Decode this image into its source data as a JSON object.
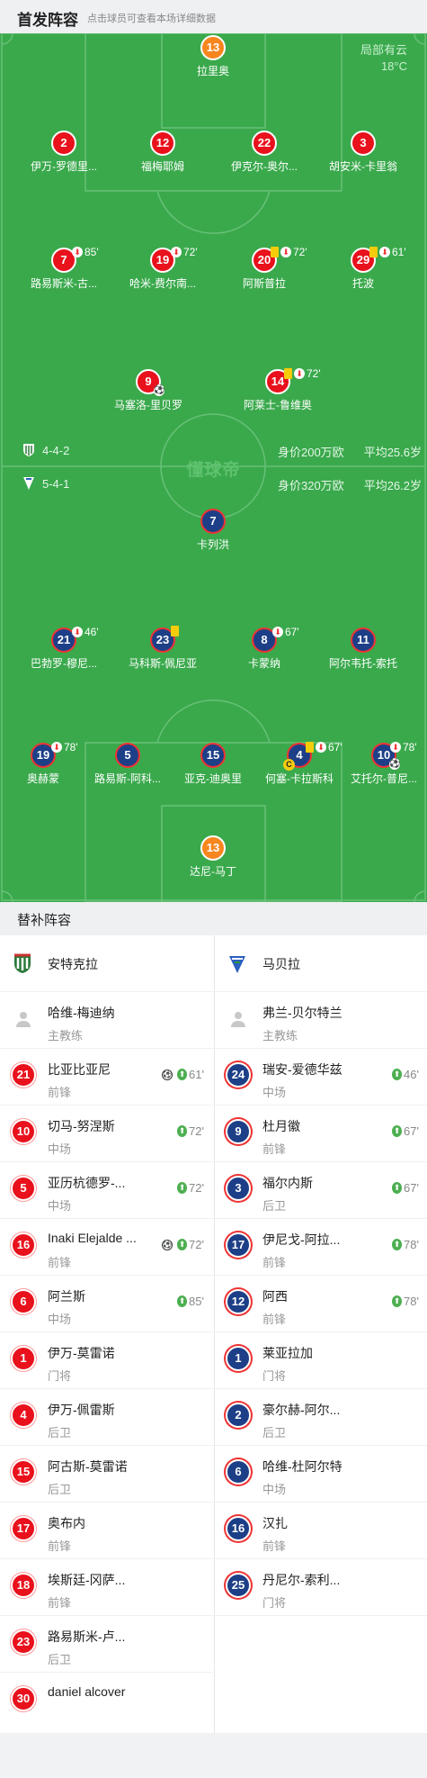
{
  "starting": {
    "title": "首发阵容",
    "hint": "点击球员可查看本场详细数据"
  },
  "weather": {
    "cond": "局部有云",
    "temp": "18°C"
  },
  "home": {
    "formation": "4-4-2",
    "value": "身价200万欧",
    "age": "平均25.6岁"
  },
  "away": {
    "formation": "5-4-1",
    "value": "身价320万欧",
    "age": "平均26.2岁"
  },
  "watermark": "懂球帝",
  "home_players": [
    {
      "num": "13",
      "name": "拉里奥",
      "gk": true
    },
    {
      "num": "2",
      "name": "伊万-罗德里..."
    },
    {
      "num": "12",
      "name": "福梅耶姆"
    },
    {
      "num": "22",
      "name": "伊克尔-奥尔..."
    },
    {
      "num": "3",
      "name": "胡安米-卡里翁"
    },
    {
      "num": "7",
      "name": "路易斯米-古...",
      "ev": "85'"
    },
    {
      "num": "19",
      "name": "哈米-费尔南...",
      "ev": "72'"
    },
    {
      "num": "20",
      "name": "阿斯普拉",
      "ev": "72'"
    },
    {
      "num": "29",
      "name": "托波",
      "ev": "61'"
    },
    {
      "num": "9",
      "name": "马塞洛-里贝罗"
    },
    {
      "num": "14",
      "name": "阿莱士-鲁维奥",
      "ev": "72'"
    }
  ],
  "away_players": [
    {
      "num": "7",
      "name": "卡列洪"
    },
    {
      "num": "21",
      "name": "巴勃罗-穆尼...",
      "ev": "46'"
    },
    {
      "num": "23",
      "name": "马科斯-佩尼亚"
    },
    {
      "num": "8",
      "name": "卡蒙纳",
      "ev": "67'"
    },
    {
      "num": "11",
      "name": "阿尔韦托-索托"
    },
    {
      "num": "19",
      "name": "奥赫蒙",
      "ev": "78'"
    },
    {
      "num": "5",
      "name": "路易斯-阿科..."
    },
    {
      "num": "15",
      "name": "亚克-迪奥里"
    },
    {
      "num": "4",
      "name": "何塞-卡拉斯科",
      "ev": "67'"
    },
    {
      "num": "10",
      "name": "艾托尔-普尼...",
      "ev": "78'"
    },
    {
      "num": "13",
      "name": "达尼-马丁",
      "gk": true
    }
  ],
  "subs": {
    "title": "替补阵容",
    "home_team": "安特克拉",
    "away_team": "马贝拉",
    "home_coach": {
      "name": "哈维-梅迪纳",
      "role": "主教练"
    },
    "away_coach": {
      "name": "弗兰-贝尔特兰",
      "role": "主教练"
    },
    "home": [
      {
        "num": "21",
        "name": "比亚比亚尼",
        "pos": "前锋",
        "ev": "61'"
      },
      {
        "num": "10",
        "name": "切马-努涅斯",
        "pos": "中场",
        "ev": "72'"
      },
      {
        "num": "5",
        "name": "亚历杭德罗-...",
        "pos": "中场",
        "ev": "72'"
      },
      {
        "num": "16",
        "name": "Inaki Elejalde ...",
        "pos": "前锋",
        "ev": "72'"
      },
      {
        "num": "6",
        "name": "阿兰斯",
        "pos": "中场",
        "ev": "85'"
      },
      {
        "num": "1",
        "name": "伊万-莫雷诺",
        "pos": "门将",
        "ev": ""
      },
      {
        "num": "4",
        "name": "伊万-佩雷斯",
        "pos": "后卫",
        "ev": ""
      },
      {
        "num": "15",
        "name": "阿古斯-莫雷诺",
        "pos": "后卫",
        "ev": ""
      },
      {
        "num": "17",
        "name": "奥布内",
        "pos": "前锋",
        "ev": ""
      },
      {
        "num": "18",
        "name": "埃斯廷-冈萨...",
        "pos": "前锋",
        "ev": ""
      },
      {
        "num": "23",
        "name": "路易斯米-卢...",
        "pos": "后卫",
        "ev": ""
      },
      {
        "num": "30",
        "name": "daniel alcover",
        "pos": "",
        "ev": ""
      }
    ],
    "away": [
      {
        "num": "24",
        "name": "瑞安-爱德华兹",
        "pos": "中场",
        "ev": "46'"
      },
      {
        "num": "9",
        "name": "杜月徽",
        "pos": "前锋",
        "ev": "67'"
      },
      {
        "num": "3",
        "name": "福尔内斯",
        "pos": "后卫",
        "ev": "67'"
      },
      {
        "num": "17",
        "name": "伊尼戈-阿拉...",
        "pos": "前锋",
        "ev": "78'"
      },
      {
        "num": "12",
        "name": "阿西",
        "pos": "前锋",
        "ev": "78'"
      },
      {
        "num": "1",
        "name": "莱亚拉加",
        "pos": "门将",
        "ev": ""
      },
      {
        "num": "2",
        "name": "豪尔赫-阿尔...",
        "pos": "后卫",
        "ev": ""
      },
      {
        "num": "6",
        "name": "哈维-杜阿尔特",
        "pos": "中场",
        "ev": ""
      },
      {
        "num": "16",
        "name": "汉扎",
        "pos": "前锋",
        "ev": ""
      },
      {
        "num": "25",
        "name": "丹尼尔-索利...",
        "pos": "门将",
        "ev": ""
      }
    ]
  },
  "colors": {
    "pitch": "#3aa94c",
    "home": "#e8111c",
    "away": "#1d3f87",
    "gk": "#f7861f"
  }
}
